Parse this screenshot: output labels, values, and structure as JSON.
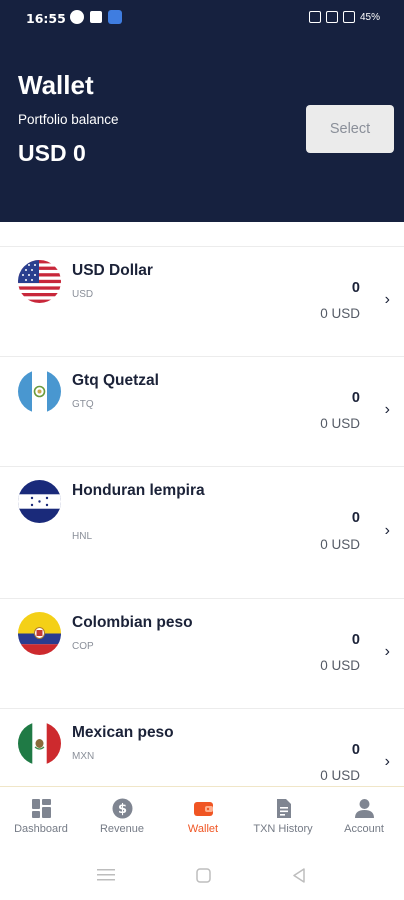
{
  "status_bar": {
    "time": "16:55",
    "battery": "45%"
  },
  "header": {
    "title": "Wallet",
    "subtitle": "Portfolio balance",
    "balance": "USD 0",
    "select_label": "Select"
  },
  "currencies": [
    {
      "name": "USD Dollar",
      "code": "USD",
      "amount": "0",
      "usd_value": "0 USD",
      "flag": "usa-flag-icon"
    },
    {
      "name": "Gtq Quetzal",
      "code": "GTQ",
      "amount": "0",
      "usd_value": "0 USD",
      "flag": "guatemala-flag-icon"
    },
    {
      "name": "Honduran lempira",
      "code": "HNL",
      "amount": "0",
      "usd_value": "0 USD",
      "flag": "honduras-flag-icon"
    },
    {
      "name": "Colombian peso",
      "code": "COP",
      "amount": "0",
      "usd_value": "0 USD",
      "flag": "colombia-flag-icon"
    },
    {
      "name": "Mexican peso",
      "code": "MXN",
      "amount": "0",
      "usd_value": "0 USD",
      "flag": "mexico-flag-icon"
    }
  ],
  "tabs": [
    {
      "label": "Dashboard",
      "icon": "dashboard-icon",
      "active": false
    },
    {
      "label": "Revenue",
      "icon": "dollar-icon",
      "active": false
    },
    {
      "label": "Wallet",
      "icon": "wallet-icon",
      "active": true
    },
    {
      "label": "TXN History",
      "icon": "document-icon",
      "active": false
    },
    {
      "label": "Account",
      "icon": "person-icon",
      "active": false
    }
  ],
  "colors": {
    "header_bg": "#16213f",
    "accent": "#f05523",
    "text": "#1b2238"
  }
}
